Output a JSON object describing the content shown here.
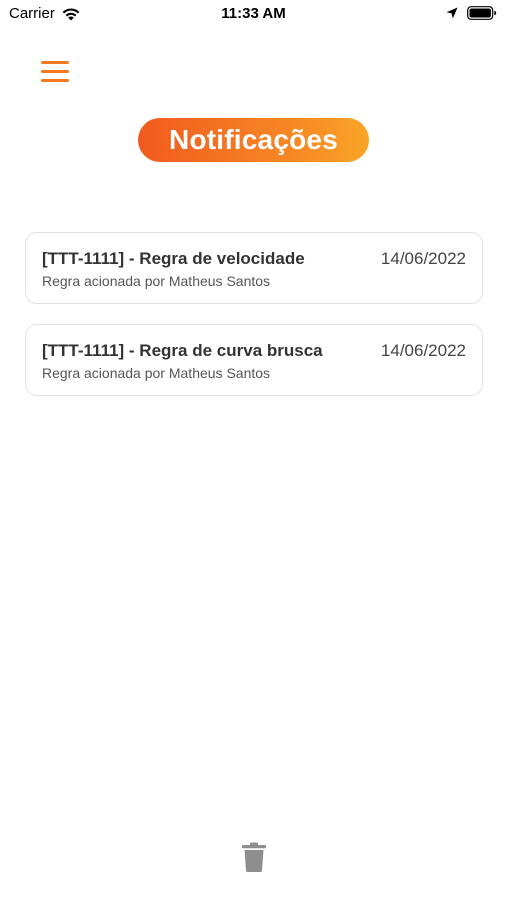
{
  "status_bar": {
    "carrier": "Carrier",
    "time": "11:33 AM"
  },
  "header": {
    "menu_icon": "hamburger-menu-icon",
    "title": "Notificações"
  },
  "colors": {
    "accent": "#f47a22",
    "title_gradient_start": "#f25a1e",
    "title_gradient_end": "#f9a526"
  },
  "notifications": [
    {
      "title": "[TTT-1111] - Regra de velocidade",
      "subtitle": "Regra acionada por Matheus Santos",
      "date": "14/06/2022"
    },
    {
      "title": "[TTT-1111] - Regra de curva brusca",
      "subtitle": "Regra acionada por Matheus Santos",
      "date": "14/06/2022"
    }
  ],
  "footer": {
    "trash_icon": "trash-icon"
  }
}
